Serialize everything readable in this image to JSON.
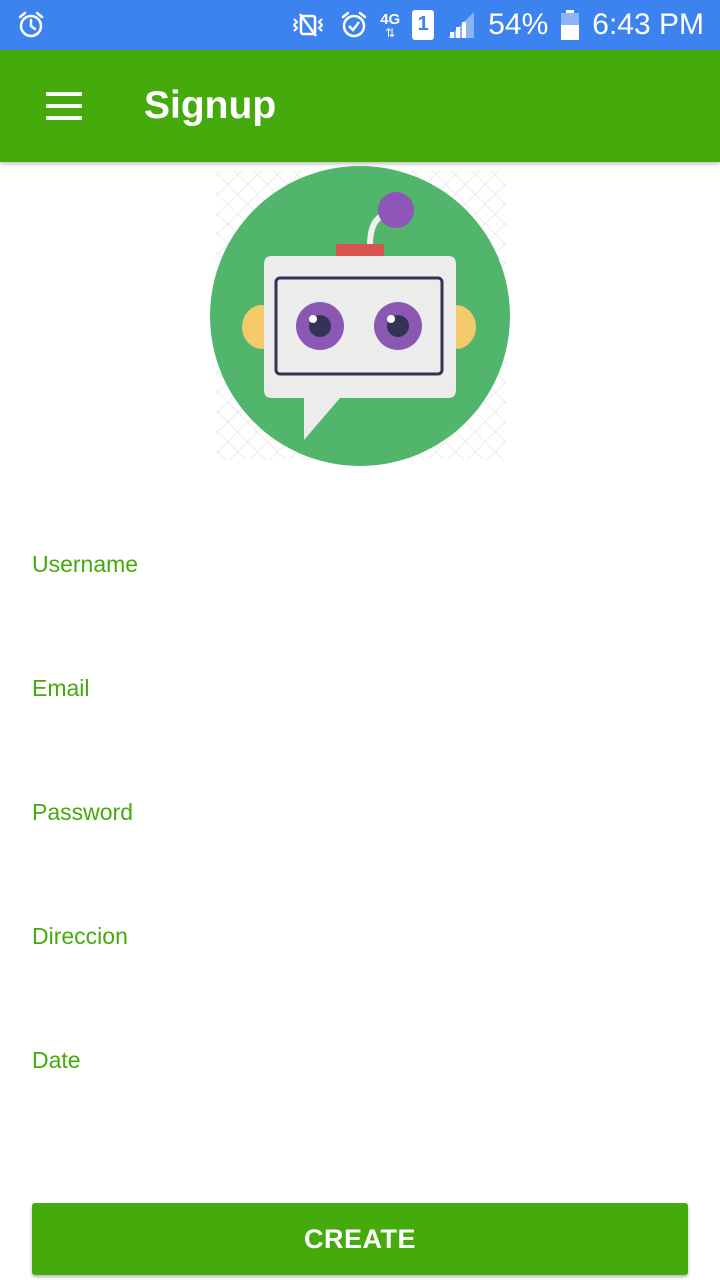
{
  "status_bar": {
    "battery_percent": "54%",
    "time": "6:43 PM",
    "network_label": "4G",
    "sim_slot": "1",
    "icons": [
      "alarm-icon",
      "vibrate-icon",
      "alarm-clock-icon",
      "network-4g-icon",
      "sim-icon",
      "signal-icon",
      "battery-icon"
    ]
  },
  "app_bar": {
    "title": "Signup",
    "menu_icon": "hamburger-menu-icon",
    "background_color": "#45aa0b"
  },
  "logo": {
    "icon": "robot-chat-icon"
  },
  "form": {
    "fields": [
      {
        "label": "Username",
        "value": ""
      },
      {
        "label": "Email",
        "value": ""
      },
      {
        "label": "Password",
        "value": ""
      },
      {
        "label": "Direccion",
        "value": ""
      },
      {
        "label": "Date",
        "value": ""
      }
    ],
    "submit_label": "CREATE"
  },
  "colors": {
    "status_bar": "#3d83f0",
    "accent": "#45aa0b",
    "label": "#45aa0b"
  }
}
